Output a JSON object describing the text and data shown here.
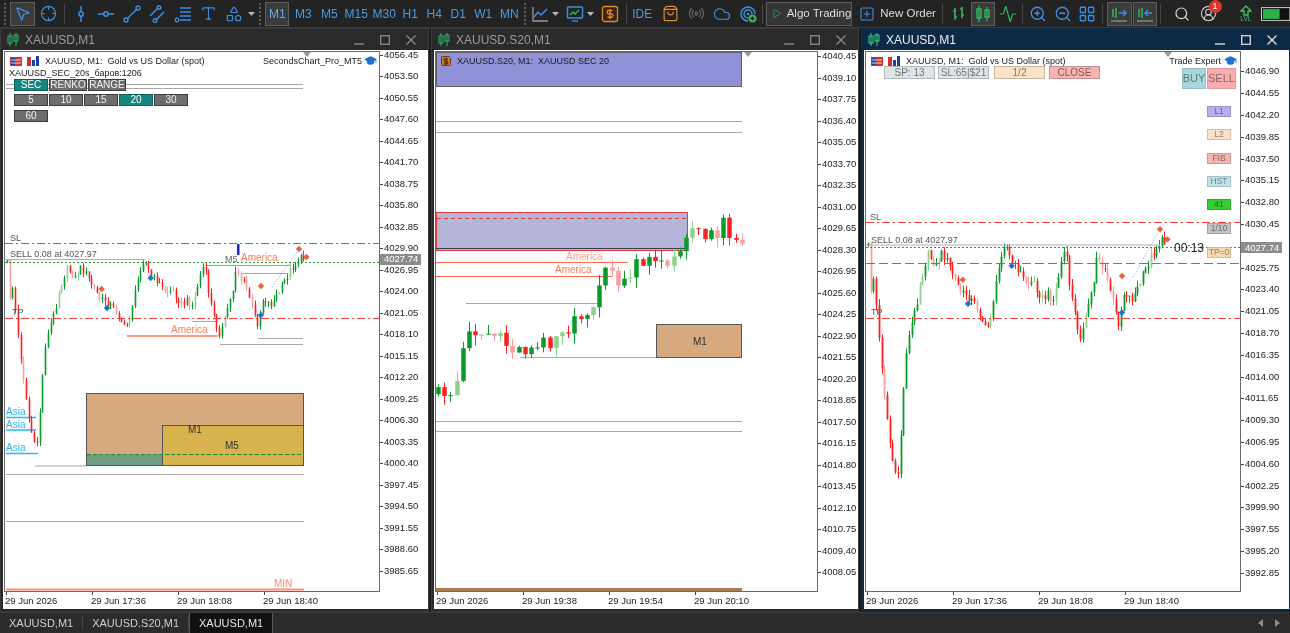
{
  "toolbar": {
    "tools": [
      {
        "selected": true
      },
      {
        "selected": false
      },
      {
        "selected": false
      },
      {
        "selected": false
      },
      {
        "selected": false
      },
      {
        "selected": false
      },
      {
        "selected": false
      },
      {
        "selected": false
      },
      {
        "selected": false
      }
    ],
    "timeframes": [
      {
        "label": "M1",
        "selected": true
      },
      {
        "label": "M3",
        "selected": false
      },
      {
        "label": "M5",
        "selected": false
      },
      {
        "label": "M15",
        "selected": false
      },
      {
        "label": "M30",
        "selected": false
      },
      {
        "label": "H1",
        "selected": false
      },
      {
        "label": "H4",
        "selected": false
      },
      {
        "label": "D1",
        "selected": false
      },
      {
        "label": "W1",
        "selected": false
      },
      {
        "label": "MN",
        "selected": false
      }
    ],
    "ide": "IDE",
    "algo_trading": "Algo Trading",
    "new_order": "New Order",
    "chart_types": [
      {
        "selected": false
      },
      {
        "selected": true
      },
      {
        "selected": false
      }
    ],
    "view_toggles": [
      {
        "selected": true
      },
      {
        "selected": true
      }
    ],
    "notifications": "1",
    "level": "LVL"
  },
  "charts": [
    {
      "kind": "seconds",
      "title": "XAUUSD,M1",
      "active": false,
      "legend": "XAUUSD, M1:  Gold vs US Dollar (spot)",
      "expert": "SecondsChart_Pro_MT5",
      "info": "XAUUSD_SEC_20s_баров:1206",
      "modes": [
        {
          "label": "SEC",
          "selected": true
        },
        {
          "label": "RENKO",
          "selected": false
        },
        {
          "label": "RANGE",
          "selected": false
        }
      ],
      "periods": [
        {
          "label": "5",
          "selected": false
        },
        {
          "label": "10",
          "selected": false
        },
        {
          "label": "15",
          "selected": false
        },
        {
          "label": "20",
          "selected": true
        },
        {
          "label": "30",
          "selected": false
        },
        {
          "label": "60",
          "selected": false
        }
      ],
      "labels": [
        "SL",
        "SELL 0.08 at 4027.97",
        "TP",
        "M5",
        "America",
        "America",
        "Asia",
        "Asia",
        "Asia",
        "M1",
        "M5",
        "MIN"
      ],
      "price_tag": "4027.74",
      "price_axis": [
        "4056.45",
        "4053.50",
        "4050.55",
        "4047.60",
        "4044.65",
        "4041.70",
        "4038.75",
        "4035.80",
        "4032.85",
        "4029.90",
        "4026.95",
        "4024.00",
        "4021.05",
        "4018.10",
        "4015.15",
        "4012.20",
        "4009.25",
        "4006.30",
        "4003.35",
        "4000.40",
        "3997.45",
        "3994.50",
        "3991.55",
        "3988.60",
        "3985.65"
      ],
      "time_axis": [
        "29 Jun 2026",
        "29 Jun 17:36",
        "29 Jun 18:08",
        "29 Jun 18:40"
      ]
    },
    {
      "kind": "custom",
      "title": "XAUUSD.S20,M1",
      "active": false,
      "legend": "XAUUSD.S20, M1:  XAUUSD SEC 20",
      "labels": [
        "America",
        "America",
        "M1"
      ],
      "price_axis": [
        "4040.45",
        "4039.10",
        "4037.75",
        "4036.40",
        "4035.05",
        "4033.70",
        "4032.35",
        "4031.00",
        "4029.65",
        "4028.30",
        "4026.95",
        "4025.60",
        "4024.25",
        "4022.90",
        "4021.55",
        "4020.20",
        "4018.85",
        "4017.50",
        "4016.15",
        "4014.80",
        "4013.45",
        "4012.10",
        "4010.75",
        "4009.40",
        "4008.05"
      ],
      "time_axis": [
        "29 Jun 2026",
        "29 Jun 19:38",
        "29 Jun 19:54",
        "29 Jun 20:10"
      ]
    },
    {
      "kind": "trade",
      "title": "XAUUSD,M1",
      "active": true,
      "legend": "XAUUSD, M1:  Gold vs US Dollar (spot)",
      "expert": "Trade Expert",
      "panel": [
        {
          "label": "SP: 13",
          "color": "#dde5e7"
        },
        {
          "label": "SL:65|$21",
          "color": "#dde5e7"
        },
        {
          "label": "1/2",
          "color": "#fde3c6"
        },
        {
          "label": "CLOSE",
          "color": "#f9b3b3"
        }
      ],
      "trade_buttons": [
        {
          "label": "BUY",
          "color": "#a8d6dd"
        },
        {
          "label": "SELL",
          "color": "#f8aeae"
        }
      ],
      "side_buttons": [
        {
          "label": "L1",
          "color": "#b4b0ec"
        },
        {
          "label": "L2",
          "color": "#fde0c8"
        },
        {
          "label": "FIB",
          "color": "#f7b2b2"
        },
        {
          "label": "HST",
          "color": "#bfe2e9"
        },
        {
          "label": "41",
          "color": "#33cc33"
        },
        {
          "label": "1/10",
          "color": "#c2c2c2"
        },
        {
          "label": "TP=0",
          "color": "#fad9b0"
        }
      ],
      "countdown": "00:13",
      "labels": [
        "SL",
        "SELL 0.08 at 4027.97",
        "TP"
      ],
      "price_tag": "4027.74",
      "price_axis": [
        "4046.90",
        "4044.55",
        "4042.20",
        "4039.85",
        "4037.50",
        "4035.15",
        "4032.80",
        "4030.45",
        "4025.75",
        "4023.40",
        "4021.05",
        "4018.70",
        "4016.35",
        "4014.00",
        "4011.65",
        "4009.30",
        "4006.95",
        "4004.60",
        "4002.25",
        "3999.90",
        "3997.55",
        "3995.20",
        "3992.85"
      ],
      "time_axis": [
        "29 Jun 2026",
        "29 Jun 17:36",
        "29 Jun 18:08",
        "29 Jun 18:40"
      ]
    }
  ],
  "tabs": [
    {
      "label": "XAUUSD,M1",
      "selected": false
    },
    {
      "label": "XAUUSD.S20,M1",
      "selected": false
    },
    {
      "label": "XAUUSD,M1",
      "selected": true
    }
  ]
}
